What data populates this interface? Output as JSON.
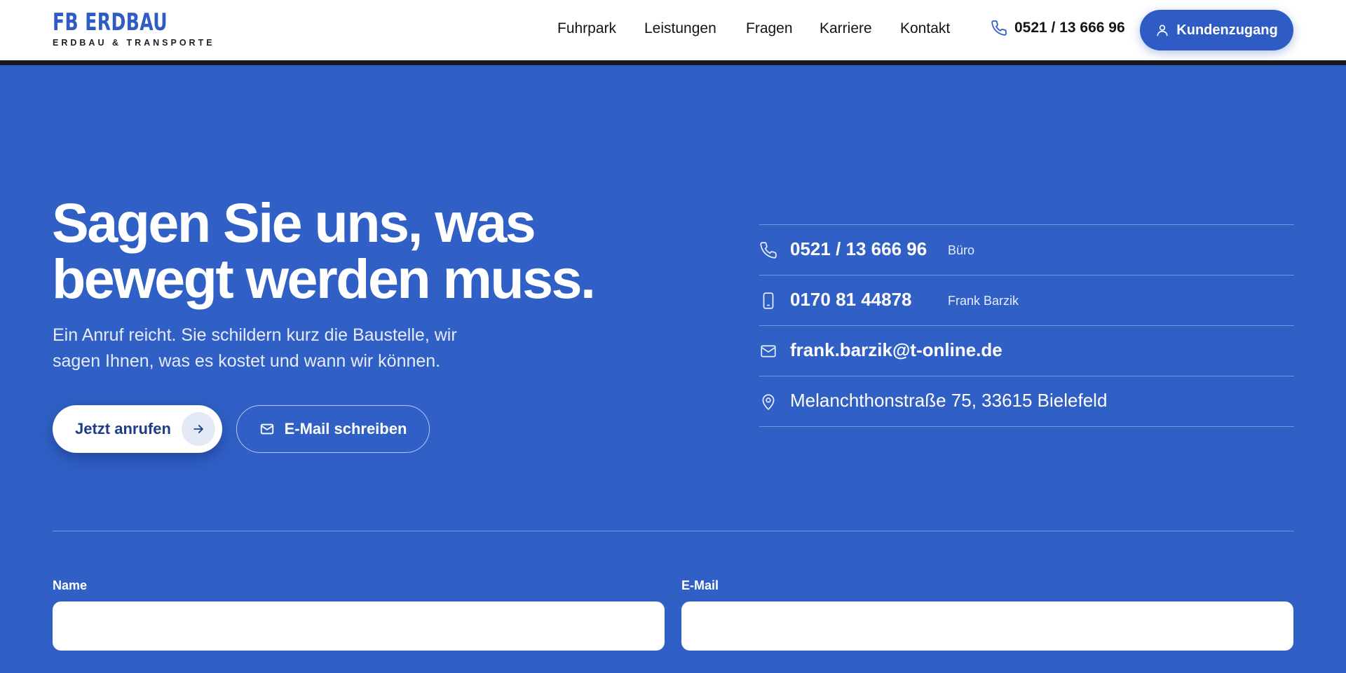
{
  "header": {
    "logo_title": "FB ERDBAU",
    "logo_subtitle": "ERDBAU & TRANSPORTE",
    "nav": [
      "Fuhrpark",
      "Leistungen",
      "Fragen",
      "Karriere",
      "Kontakt"
    ],
    "phone": "0521 / 13 666 96",
    "account_label": "Kundenzugang",
    "icons": {
      "phone": "phone-icon",
      "account": "user-icon"
    }
  },
  "hero": {
    "headline_line1": "Sagen Sie uns, was",
    "headline_line2": "bewegt werden muss.",
    "subtext": "Ein Anruf reicht. Sie schildern kurz die Baustelle, wir sagen Ihnen, was es kostet und wann wir können.",
    "call_button": "Jetzt anrufen",
    "mail_button": "E-Mail schreiben"
  },
  "contact": {
    "rows": [
      {
        "icon": "phone-icon",
        "value": "0521 / 13 666 96",
        "note": "Büro"
      },
      {
        "icon": "mobile-icon",
        "value": "0170 81 44878",
        "note": "Frank Barzik"
      },
      {
        "icon": "mail-icon",
        "value": "frank.barzik@t-online.de",
        "note": ""
      },
      {
        "icon": "location-pin-icon",
        "value": "Melanchthonstraße 75, 33615 Bielefeld",
        "note": ""
      }
    ]
  },
  "form": {
    "name_label": "Name",
    "email_label": "E-Mail",
    "name_value": "",
    "email_value": ""
  },
  "colors": {
    "brand_blue": "#2F5CC4",
    "hero_bg": "#3060C6",
    "header_bar": "#18191f"
  }
}
